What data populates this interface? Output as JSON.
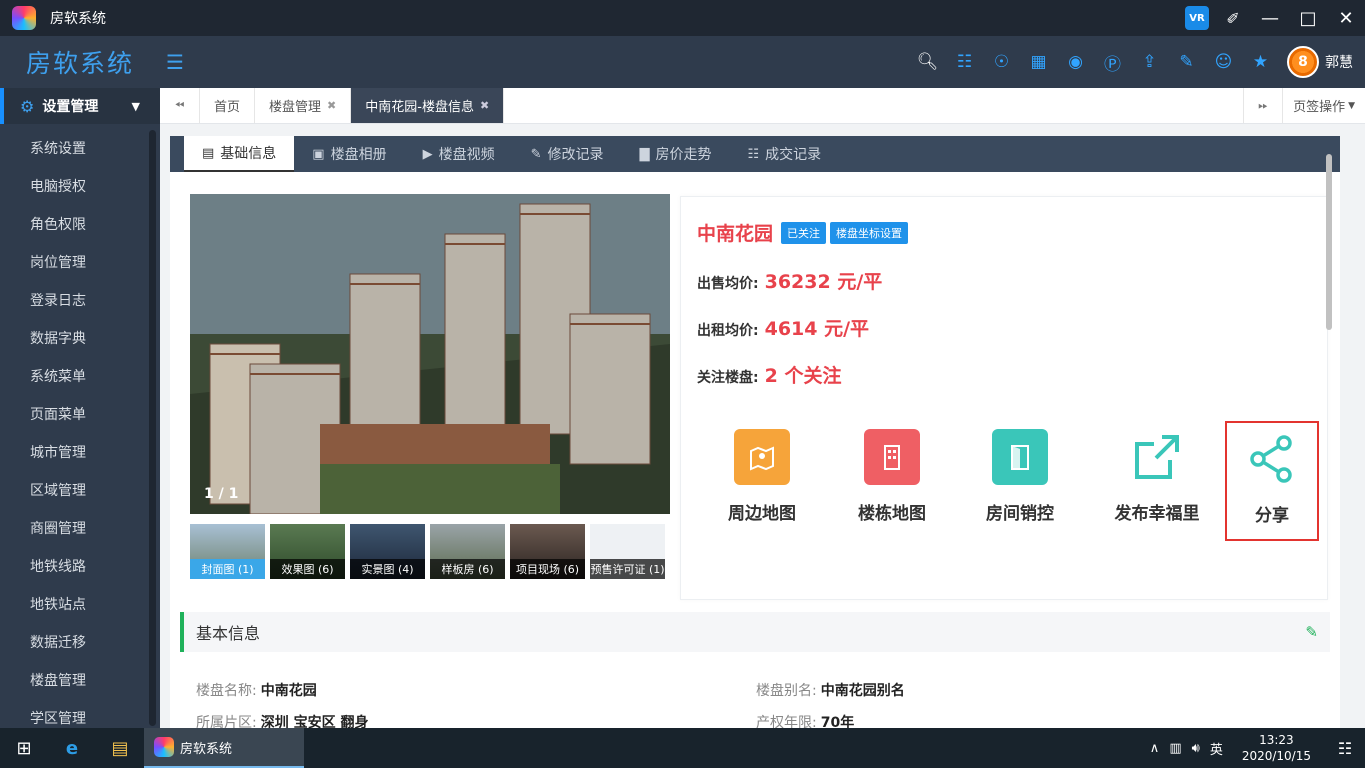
{
  "window": {
    "title": "房软系统"
  },
  "header": {
    "brand": "房软系统",
    "username": "郭慧",
    "avatar_text": "8",
    "icons": [
      "search-icon",
      "phone-icon",
      "contact-card-icon",
      "grid-apps-icon",
      "location-icon",
      "help-icon",
      "upload-icon",
      "edit-note-icon",
      "user-pin-icon",
      "runner-icon"
    ]
  },
  "sidebar": {
    "group_title": "设置管理",
    "items": [
      "系统设置",
      "电脑授权",
      "角色权限",
      "岗位管理",
      "登录日志",
      "数据字典",
      "系统菜单",
      "页面菜单",
      "城市管理",
      "区域管理",
      "商圈管理",
      "地铁线路",
      "地铁站点",
      "数据迁移",
      "楼盘管理",
      "学区管理"
    ]
  },
  "tabs": {
    "items": [
      {
        "label": "首页"
      },
      {
        "label": "楼盘管理"
      },
      {
        "label": "中南花园-楼盘信息"
      }
    ],
    "ops_label": "页签操作"
  },
  "subtabs": [
    "基础信息",
    "楼盘相册",
    "楼盘视频",
    "修改记录",
    "房价走势",
    "成交记录"
  ],
  "gallery": {
    "counter": "1 / 1",
    "thumbs": [
      "封面图 (1)",
      "效果图 (6)",
      "实景图 (4)",
      "样板房 (6)",
      "项目现场 (6)",
      "预售许可证 (1)"
    ]
  },
  "estate": {
    "name": "中南花园",
    "badge_followed": "已关注",
    "badge_coords": "楼盘坐标设置",
    "sale_label": "出售均价:",
    "sale_value": "36232 元/平",
    "rent_label": "出租均价:",
    "rent_value": "4614 元/平",
    "follow_label": "关注楼盘:",
    "follow_value": "2 个关注"
  },
  "actions": {
    "nearby_map": "周边地图",
    "building_map": "楼栋地图",
    "room_control": "房间销控",
    "publish": "发布幸福里",
    "share": "分享"
  },
  "basic_info": {
    "title": "基本信息",
    "name_label": "楼盘名称:",
    "name_value": "中南花园",
    "alias_label": "楼盘别名:",
    "alias_value": "中南花园别名",
    "area_label": "所属片区:",
    "area_value": "深圳 宝安区 翻身",
    "term_label": "产权年限:",
    "term_value": "70年"
  },
  "taskbar": {
    "app_label": "房软系统",
    "ime": "英",
    "time": "13:23",
    "date": "2020/10/15"
  },
  "colors": {
    "accent": "#1f92ea",
    "price_red": "#e8424b",
    "nearby_map": "#f6a43a",
    "building_map": "#ef5f64",
    "room_control": "#3ac6b9",
    "publish": "#3ac6b9",
    "share": "#3ac6b9"
  }
}
